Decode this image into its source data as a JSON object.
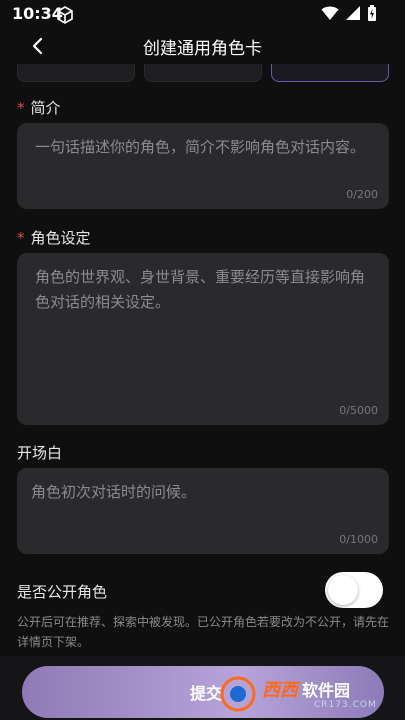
{
  "status_bar": {
    "time": "10:34",
    "icons": [
      "sim-card-icon",
      "wifi-icon",
      "signal-icon",
      "battery-icon"
    ]
  },
  "header": {
    "title": "创建通用角色卡",
    "back_icon": "chevron-left-icon"
  },
  "form": {
    "required_marker": "*",
    "intro": {
      "label": "简介",
      "placeholder": "一句话描述你的角色，简介不影响角色对话内容。",
      "counter": "0/200"
    },
    "setting": {
      "label": "角色设定",
      "placeholder": "角色的世界观、身世背景、重要经历等直接影响角色对话的相关设定。",
      "counter": "0/5000"
    },
    "greeting": {
      "label": "开场白",
      "placeholder": "角色初次对话时的问候。",
      "counter": "0/1000"
    },
    "public_toggle": {
      "label": "是否公开角色",
      "state": "off",
      "helper": "公开后可在推荐、探索中被发现。已公开角色若要改为不公开，请先在详情页下架。"
    }
  },
  "footer": {
    "submit_label": "提交",
    "submit_gradient": [
      "#8f7ab5",
      "#b7a4d9"
    ]
  },
  "watermark": {
    "main": "西西",
    "suffix": "软件园",
    "sub": "CR173.COM"
  },
  "colors": {
    "background": "#0f0f10",
    "field": "#2a2a2c",
    "required": "#e2463f",
    "accent_border": "#6a5aa5"
  }
}
